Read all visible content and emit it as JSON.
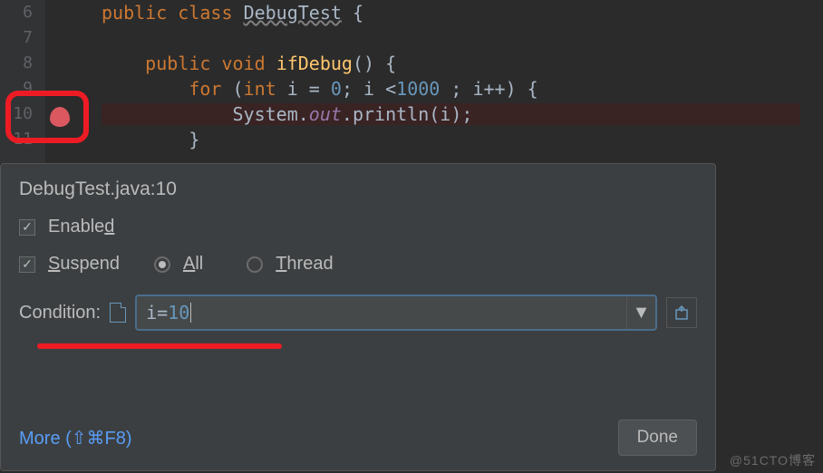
{
  "editor": {
    "lines": [
      "6",
      "7",
      "8",
      "9",
      "10",
      "11"
    ],
    "code": {
      "l6": {
        "kw1": "public",
        "kw2": "class",
        "cls": "DebugTest",
        "brace": "{"
      },
      "l8": {
        "kw1": "public",
        "kw2": "void",
        "mth": "ifDebug",
        "rest": "() {"
      },
      "l9": {
        "kw": "for",
        "open": "(",
        "int": "int",
        "var": "i = ",
        "zero": "0",
        "mid": "; i <",
        "lim": "1000",
        "end": " ; i++) {"
      },
      "l10": {
        "sys": "System.",
        "out": "out",
        "dot": ".println(i);"
      },
      "l11": {
        "brace": "}"
      }
    }
  },
  "popup": {
    "title": "DebugTest.java:10",
    "enabled_label": "Enabled",
    "enabled_u": "d",
    "suspend_label": "Suspend",
    "suspend_u": "S",
    "all_label": "All",
    "all_u": "A",
    "thread_label": "Thread",
    "thread_u": "T",
    "condition_label": "Condition:",
    "condition_value_var": "i",
    "condition_value_eq": "=",
    "condition_value_num": "10",
    "more_label": "More (⇧⌘F8)",
    "done_label": "Done"
  },
  "watermark": "@51CTO博客"
}
